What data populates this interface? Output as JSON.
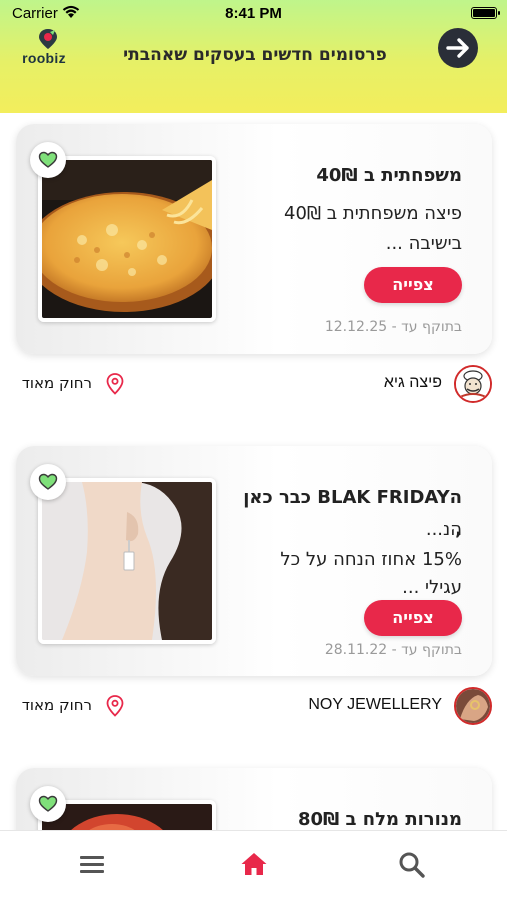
{
  "status_bar": {
    "carrier": "Carrier",
    "time": "8:41 PM"
  },
  "header": {
    "logo_text": "roobiz",
    "title": "פרסומים חדשים בעסקים שאהבתי"
  },
  "cards": [
    {
      "title": "משפחתית ב 40₪",
      "description_lines": [
        "פיצה משפחתית ב 40₪",
        "בישיבה ..."
      ],
      "button_label": "צפייה",
      "valid_until": "בתוקף עד - 12.12.25",
      "business_name": "פיצה גיא",
      "distance": "רחוק מאוד"
    },
    {
      "title_lines": [
        "הBLAK FRIDAY כבר כאן ,",
        "הנ..."
      ],
      "description_lines": [
        "15% אחוז הנחה על כל",
        "עגילי ..."
      ],
      "button_label": "צפייה",
      "valid_until": "בתוקף עד - 28.11.22",
      "business_name": "NOY JEWELLERY",
      "distance": "רחוק מאוד"
    },
    {
      "title": "מנורות מלח ב 80₪"
    }
  ],
  "bottom_nav": {
    "items": [
      "menu-icon",
      "home-icon",
      "search-icon"
    ],
    "active": "home-icon",
    "active_color": "#e8284a"
  },
  "colors": {
    "accent": "#e8284a",
    "heart": "#7fe07a"
  }
}
